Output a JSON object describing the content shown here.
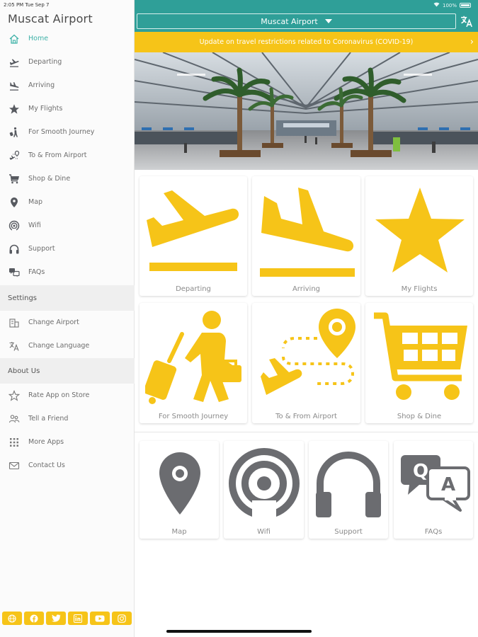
{
  "status_bar": {
    "time": "2:05 PM  Tue Sep 7",
    "battery": "100%"
  },
  "app_title": "Muscat Airport",
  "menu": [
    {
      "label": "Home",
      "icon": "home-icon",
      "active": true
    },
    {
      "label": "Departing",
      "icon": "departing-plane-icon",
      "active": false
    },
    {
      "label": "Arriving",
      "icon": "arriving-plane-icon",
      "active": false
    },
    {
      "label": "My Flights",
      "icon": "star-icon",
      "active": false
    },
    {
      "label": "For Smooth Journey",
      "icon": "traveler-icon",
      "active": false
    },
    {
      "label": "To & From Airport",
      "icon": "route-icon",
      "active": false
    },
    {
      "label": "Shop & Dine",
      "icon": "cart-icon",
      "active": false
    },
    {
      "label": "Map",
      "icon": "map-pin-icon",
      "active": false
    },
    {
      "label": "Wifi",
      "icon": "wifi-icon",
      "active": false
    },
    {
      "label": "Support",
      "icon": "headphones-icon",
      "active": false
    },
    {
      "label": "FAQs",
      "icon": "faq-icon",
      "active": false
    }
  ],
  "settings": {
    "heading": "Settings",
    "items": [
      {
        "label": "Change Airport",
        "icon": "building-icon"
      },
      {
        "label": "Change Language",
        "icon": "translate-icon"
      }
    ]
  },
  "about": {
    "heading": "About Us",
    "items": [
      {
        "label": "Rate App on Store",
        "icon": "star-outline-icon"
      },
      {
        "label": "Tell a Friend",
        "icon": "people-icon"
      },
      {
        "label": "More Apps",
        "icon": "grid-icon"
      },
      {
        "label": "Contact Us",
        "icon": "mail-icon"
      }
    ]
  },
  "social": [
    "globe-icon",
    "facebook-icon",
    "twitter-icon",
    "linkedin-icon",
    "youtube-icon",
    "instagram-icon"
  ],
  "header": {
    "airport": "Muscat Airport"
  },
  "banner": {
    "text": "Update on travel restrictions related to Coronavirus (COVID-19)"
  },
  "tiles_large": [
    {
      "label": "Departing",
      "icon": "departing-plane-icon"
    },
    {
      "label": "Arriving",
      "icon": "arriving-plane-icon"
    },
    {
      "label": "My Flights",
      "icon": "star-icon"
    },
    {
      "label": "For Smooth Journey",
      "icon": "traveler-icon"
    },
    {
      "label": "To & From Airport",
      "icon": "route-icon"
    },
    {
      "label": "Shop & Dine",
      "icon": "cart-icon"
    }
  ],
  "tiles_small": [
    {
      "label": "Map",
      "icon": "map-pin-icon"
    },
    {
      "label": "Wifi",
      "icon": "wifi-icon"
    },
    {
      "label": "Support",
      "icon": "headphones-icon"
    },
    {
      "label": "FAQs",
      "icon": "faq-icon"
    }
  ],
  "faq_letters": {
    "q": "Q",
    "a": "A"
  },
  "colors": {
    "accent": "#2f9f98",
    "yellow": "#f6c418",
    "gray_icon": "#6b6c70",
    "active_menu": "#3fb2a8"
  }
}
